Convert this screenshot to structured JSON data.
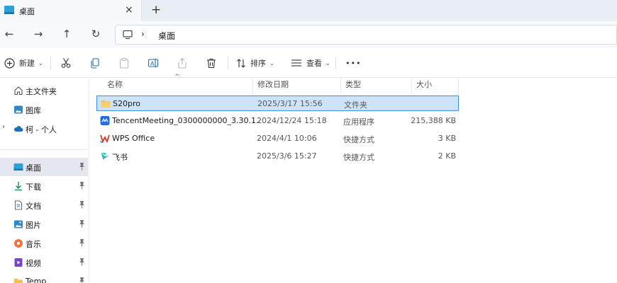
{
  "tab": {
    "title": "桌面",
    "close": "×",
    "new": "+"
  },
  "nav_buttons": {
    "back": "←",
    "forward": "→",
    "up": "↑",
    "refresh": "↻"
  },
  "address": {
    "chevron": "›",
    "path": "桌面"
  },
  "toolbar": {
    "new_label": "新建",
    "sort_label": "排序",
    "view_label": "查看",
    "more": "•••",
    "caret": "⌄"
  },
  "sidebar": {
    "items": [
      {
        "label": "主文件夹",
        "icon": "home-icon"
      },
      {
        "label": "图库",
        "icon": "gallery-icon"
      },
      {
        "label": "柯 - 个人",
        "icon": "cloud-icon",
        "expand": "›"
      },
      {
        "label": "桌面",
        "icon": "desktop-folder-icon"
      },
      {
        "label": "下载",
        "icon": "download-icon"
      },
      {
        "label": "文档",
        "icon": "document-icon"
      },
      {
        "label": "图片",
        "icon": "pictures-icon"
      },
      {
        "label": "音乐",
        "icon": "music-icon"
      },
      {
        "label": "视频",
        "icon": "video-icon"
      },
      {
        "label": "Temp",
        "icon": "folder-icon"
      }
    ]
  },
  "columns": {
    "name": "名称",
    "date": "修改日期",
    "type": "类型",
    "size": "大小",
    "sort_indicator": "^"
  },
  "files": [
    {
      "name": "S20pro",
      "date": "2025/3/17 15:56",
      "type": "文件夹",
      "size": "",
      "icon": "folder-icon"
    },
    {
      "name": "TencentMeeting_0300000000_3.30.1...",
      "date": "2024/12/24 15:18",
      "type": "应用程序",
      "size": "215,388 KB",
      "icon": "tencent-meeting-icon"
    },
    {
      "name": "WPS Office",
      "date": "2024/4/1 10:06",
      "type": "快捷方式",
      "size": "3 KB",
      "icon": "wps-icon"
    },
    {
      "name": "飞书",
      "date": "2025/3/6 15:27",
      "type": "快捷方式",
      "size": "2 KB",
      "icon": "feishu-icon"
    }
  ],
  "colors": {
    "accent": "#3f8fe0",
    "selection": "#cce4fa",
    "folder": "#f3c04d"
  }
}
